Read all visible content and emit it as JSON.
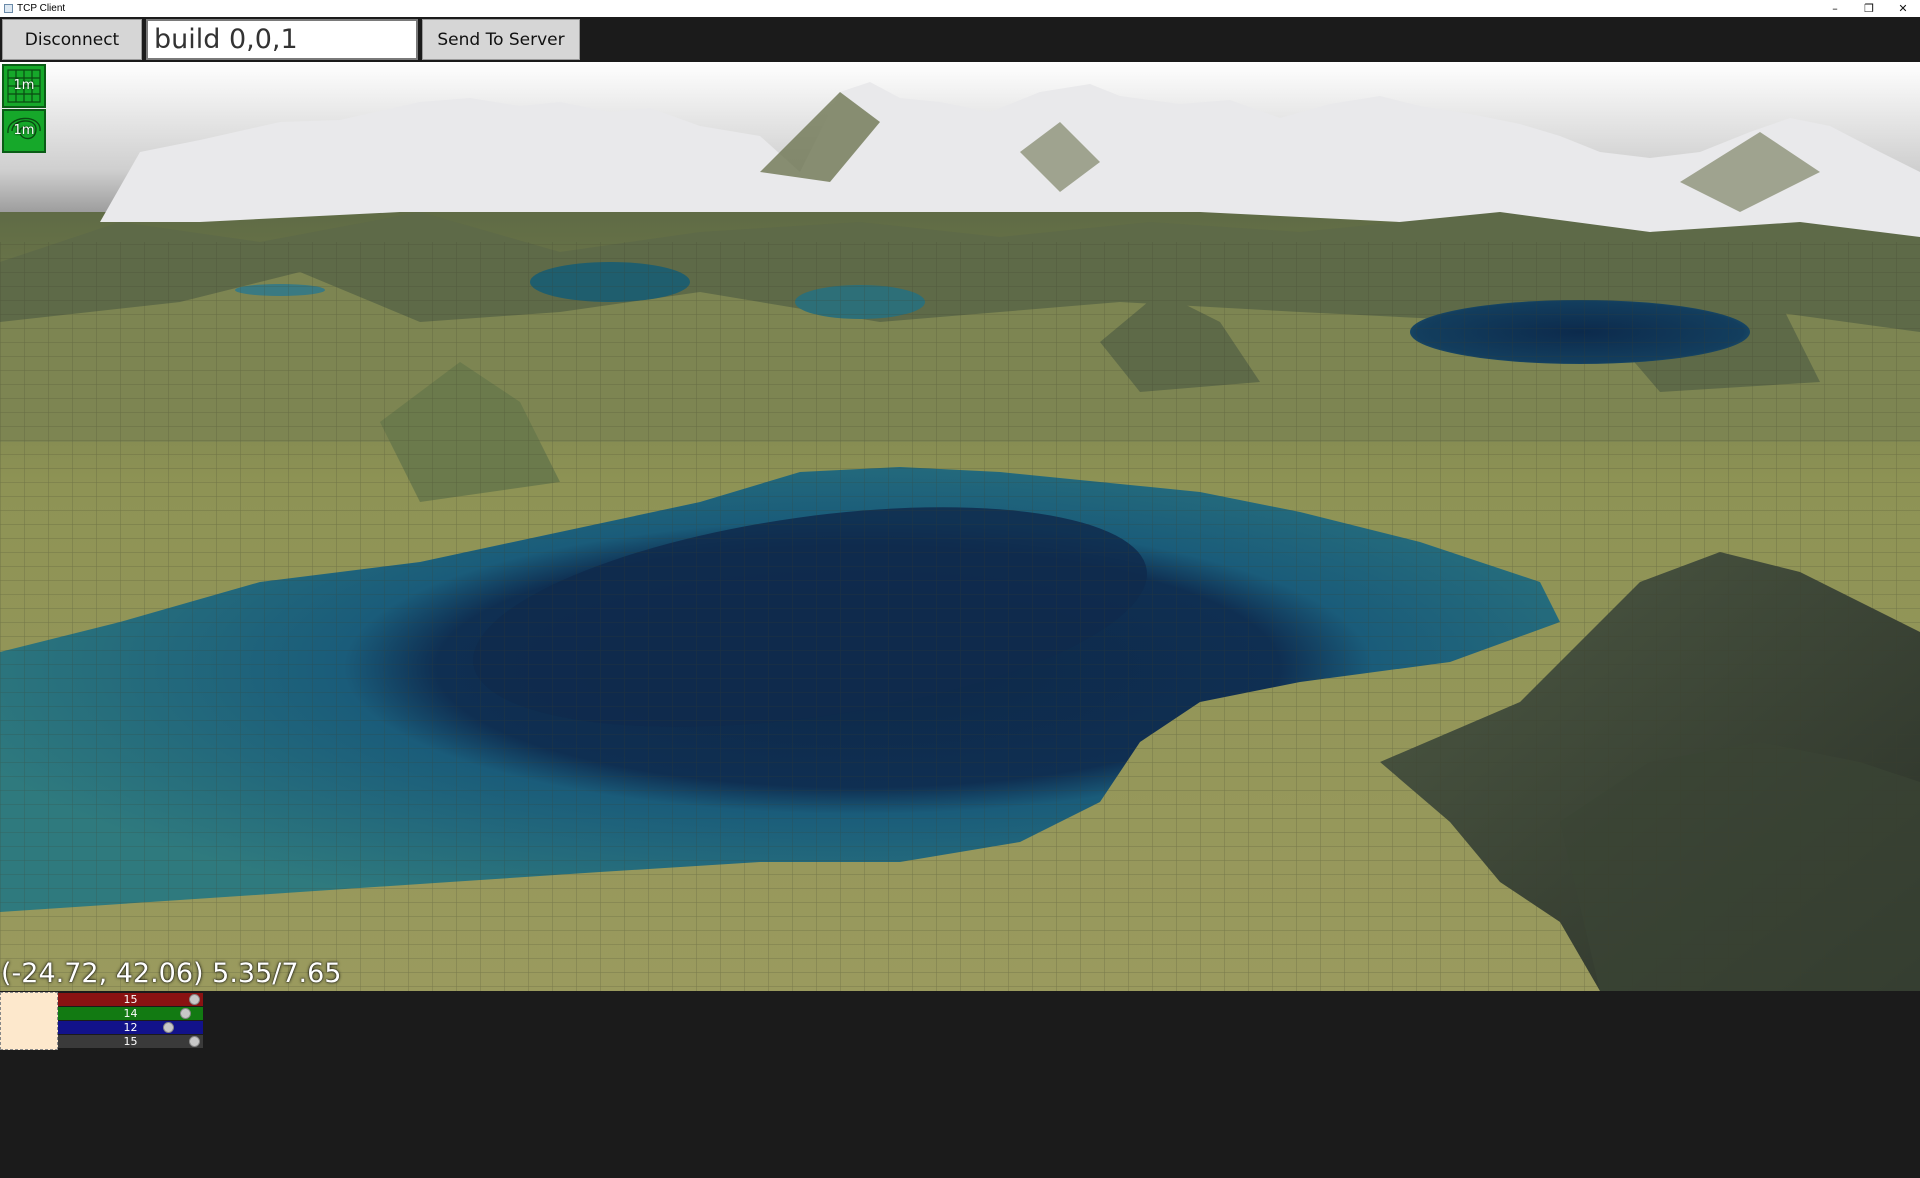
{
  "window": {
    "title": "TCP Client"
  },
  "titlebar_controls": {
    "minimize": "–",
    "restore": "❐",
    "close": "✕"
  },
  "toolbar": {
    "disconnect_label": "Disconnect",
    "command_value": "build 0,0,1",
    "send_label": "Send To Server"
  },
  "tools": {
    "grid_label": "1m",
    "contour_label": "1m"
  },
  "status": {
    "coords": "(-24.72, 42.06) 5.35/7.65"
  },
  "color_panel": {
    "swatch_color": "#fde8cc",
    "red": {
      "label": "15",
      "level": 1.0
    },
    "green": {
      "label": "14",
      "level": 0.93
    },
    "blue": {
      "label": "12",
      "level": 0.8
    },
    "alpha": {
      "label": "15",
      "level": 1.0
    }
  },
  "colors": {
    "background": "#1b1b1b",
    "tool_green": "#16a82a",
    "lake": "#1a5a6a",
    "deep_water": "#0e2a4a",
    "terrain": "#8a8f55",
    "snow": "#e8e8ea"
  }
}
